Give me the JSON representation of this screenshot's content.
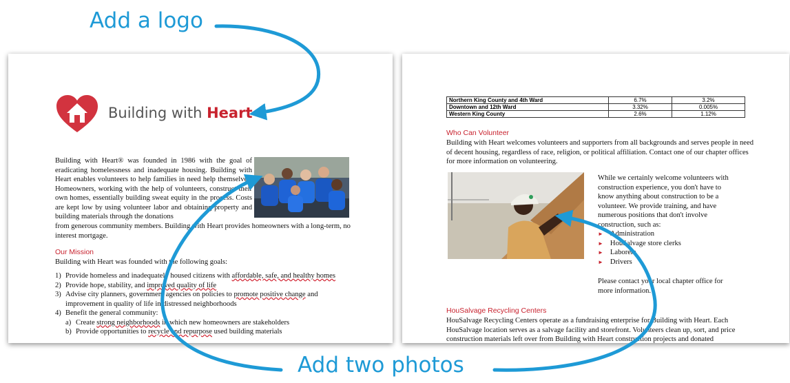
{
  "callouts": {
    "logo": "Add a logo",
    "photos": "Add two photos"
  },
  "colors": {
    "accent": "#1e9ad6",
    "brand_red": "#c8222e"
  },
  "page1": {
    "logo": {
      "icon": "heart-house-icon",
      "text_plain": "Building with ",
      "text_bold": "Heart"
    },
    "intro": "Building with Heart® was founded in 1986 with the goal of eradicating homelessness and inadequate housing. Building with Heart enables volunteers to help families in need help themselves. Homeowners, working with the help of volunteers, construct their own homes, essentially building sweat equity in the process. Costs are kept low by using volunteer labor and obtaining property and building materials through the donations from generous community members. Building with Heart provides homeowners with a long-term, no interest mortgage.",
    "mission_heading": "Our Mission",
    "mission_lead": "Building with Heart was founded with the following goals:",
    "goals": [
      {
        "num": "1)",
        "pre": "Provide homeless and inadequately housed citizens with ",
        "link": "affordable, safe, and healthy homes",
        "post": ""
      },
      {
        "num": "2)",
        "pre": "Provide hope, stability, and ",
        "link": "improved quality of life",
        "post": ""
      },
      {
        "num": "3)",
        "pre": "Advise city planners, government agencies on policies to ",
        "link": "promote positive change",
        "post": " and improvement in quality of life in distressed neighborhoods"
      },
      {
        "num": "4)",
        "pre": "Benefit the general community:",
        "link": "",
        "post": ""
      }
    ],
    "subgoals": [
      {
        "num": "a)",
        "pre": "Create ",
        "link": "strong neighborhoods",
        "post": " in which new homeowners are stakeholders"
      },
      {
        "num": "b)",
        "pre": "Provide opportunities to ",
        "link": "recycle and repurpose",
        "post": " used building materials"
      }
    ]
  },
  "page2": {
    "table_rows": [
      {
        "name": "Northern King County and 4th Ward",
        "v1": "6.7%",
        "v2": "3.2%"
      },
      {
        "name": "Downtown and 12th Ward",
        "v1": "3.32%",
        "v2": "0.005%"
      },
      {
        "name": "Western King County",
        "v1": "2.6%",
        "v2": "1.12%"
      }
    ],
    "volunteer_heading": "Who Can Volunteer",
    "volunteer_text": "Building with Heart welcomes volunteers and supporters from all backgrounds and serves people in need of decent housing, regardless of race, religion, or political affiliation. Contact one of our chapter offices for more information on volunteering.",
    "side_text": "While we certainly welcome volunteers with construction experience, you don't have to know anything about construction to be a volunteer. We provide training, and have numerous positions that don't involve construction, such as:",
    "positions": [
      "Administration",
      "HouSalvage store clerks",
      "Laborers",
      "Drivers"
    ],
    "contact_text": "Please contact your local chapter office for more information.",
    "recycling_heading": "HouSalvage Recycling Centers",
    "recycling_text": "HouSalvage Recycling Centers operate as a fundraising enterprise for Building with Heart. Each HouSalvage location serves as a salvage facility and storefront. Volunteers clean up, sort, and price construction materials left over from Building with Heart construction projects and donated"
  }
}
